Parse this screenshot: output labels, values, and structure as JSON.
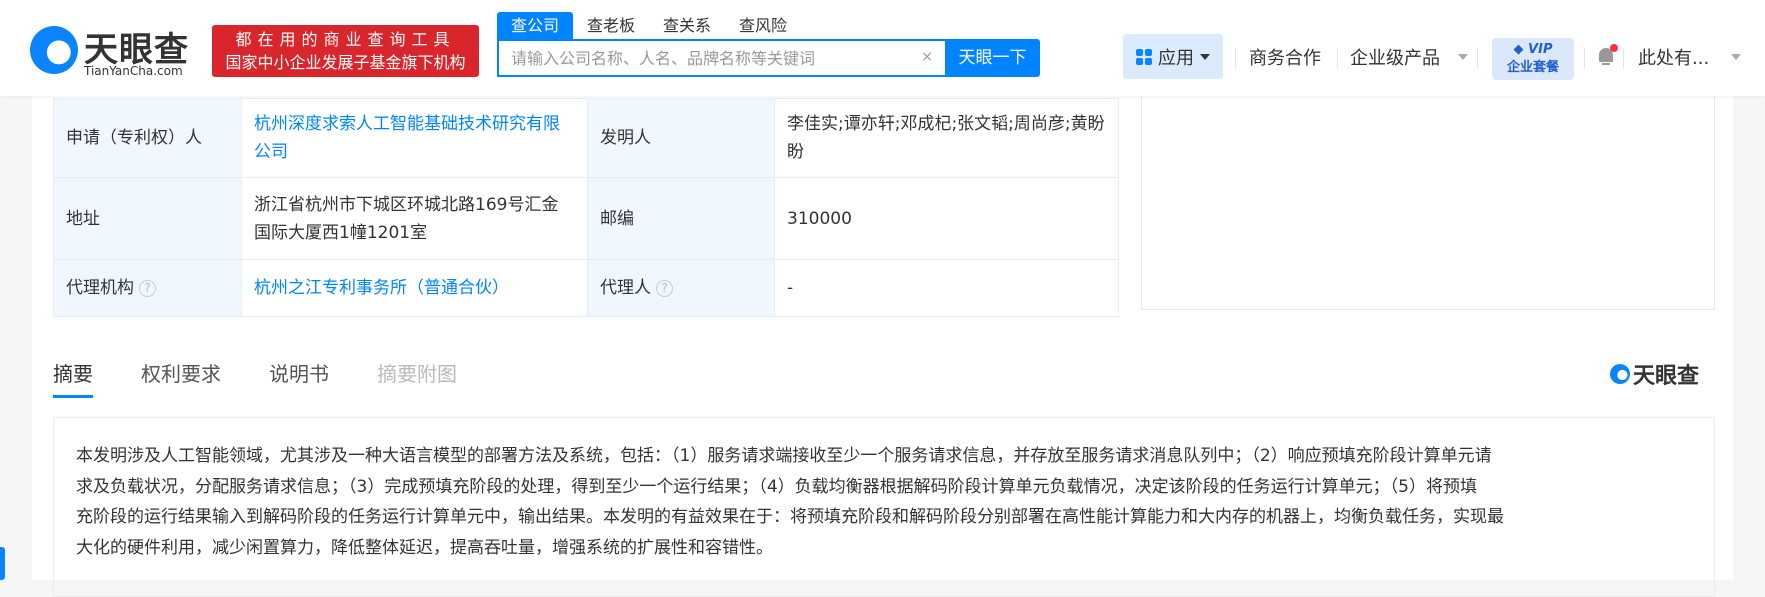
{
  "header": {
    "logo_name": "天眼查",
    "logo_domain": "TianYanCha.com",
    "badge_line1": "都在用的商业查询工具",
    "badge_line2": "国家中小企业发展子基金旗下机构",
    "search_tabs": [
      {
        "label": "查公司",
        "active": true
      },
      {
        "label": "查老板"
      },
      {
        "label": "查关系"
      },
      {
        "label": "查风险"
      }
    ],
    "search_placeholder": "请输入公司名称、人名、品牌名称等关键词",
    "clear_label": "×",
    "search_button": "天眼一下",
    "apps_label": "应用",
    "biz_label": "商务合作",
    "enterprise_label": "企业级产品",
    "vip_line1": "VIP",
    "vip_line2": "企业套餐",
    "user_label": "此处有..."
  },
  "table": {
    "rows": [
      {
        "k1": "申请（专利权）人",
        "v1": "杭州深度求索人工智能基础技术研究有限公司",
        "k2": "发明人",
        "v2": "李佳实;谭亦轩;邓成杞;张文韬;周尚彦;黄盼盼"
      },
      {
        "k1": "地址",
        "v1": "浙江省杭州市下城区环城北路169号汇金国际大厦西1幢1201室",
        "k2": "邮编",
        "v2": "310000"
      },
      {
        "k1": "代理机构",
        "v1": "杭州之江专利事务所（普通合伙）",
        "k2": "代理人",
        "v2": "-"
      }
    ],
    "help_glyph": "?"
  },
  "content_tabs": [
    {
      "label": "摘要",
      "active": true
    },
    {
      "label": "权利要求"
    },
    {
      "label": "说明书"
    },
    {
      "label": "摘要附图",
      "disabled": true
    }
  ],
  "watermark_logo": "天眼查",
  "abstract_lines": [
    "本发明涉及人工智能领域，尤其涉及一种大语言模型的部署方法及系统，包括：（1）服务请求端接收至少一个服务请求信息，并存放至服务请求消息队列中；（2）响应预填充阶段计算单元请",
    "求及负载状况，分配服务请求信息；（3）完成预填充阶段的处理，得到至少一个运行结果；（4）负载均衡器根据解码阶段计算单元负载情况，决定该阶段的任务运行计算单元；（5）将预填",
    "充阶段的运行结果输入到解码阶段的任务运行计算单元中，输出结果。本发明的有益效果在于：将预填充阶段和解码阶段分别部署在高性能计算能力和大内存的机器上，均衡负载任务，实现最",
    "大化的硬件利用，减少闲置算力，降低整体延迟，提高吞吐量，增强系统的扩展性和容错性。"
  ],
  "colors": {
    "brand": "#0084ff",
    "badge": "#d9262c"
  }
}
